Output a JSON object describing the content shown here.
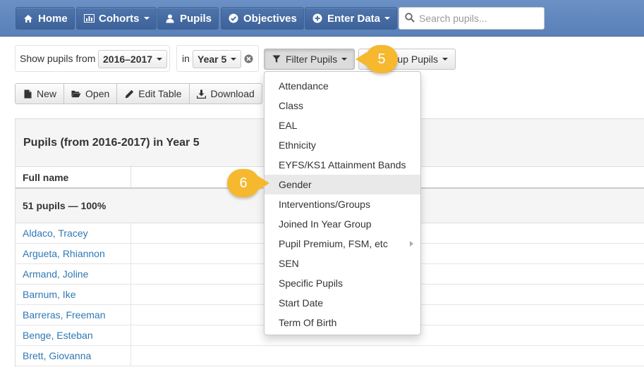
{
  "navbar": {
    "home": "Home",
    "cohorts": "Cohorts",
    "pupils": "Pupils",
    "objectives": "Objectives",
    "enter_data": "Enter Data",
    "search_placeholder": "Search pupils..."
  },
  "filterbar": {
    "show_from_label": "Show pupils from",
    "year_range": "2016–2017",
    "in_label": "in",
    "year_group": "Year 5",
    "filter_button": "Filter Pupils",
    "group_button_partial": "up Pupils"
  },
  "toolbar": {
    "new": "New",
    "open": "Open",
    "edit_table": "Edit Table",
    "download": "Download"
  },
  "table": {
    "title": "Pupils (from 2016-2017) in Year 5",
    "col_full_name": "Full name",
    "summary": "51 pupils — 100%",
    "rows": [
      "Aldaco, Tracey",
      "Argueta, Rhiannon",
      "Armand, Joline",
      "Barnum, Ike",
      "Barreras, Freeman",
      "Benge, Esteban",
      "Brett, Giovanna"
    ]
  },
  "filter_menu": {
    "items": [
      "Attendance",
      "Class",
      "EAL",
      "Ethnicity",
      "EYFS/KS1 Attainment Bands",
      "Gender",
      "Interventions/Groups",
      "Joined In Year Group",
      "Pupil Premium, FSM, etc",
      "SEN",
      "Specific Pupils",
      "Start Date",
      "Term Of Birth"
    ],
    "highlighted": "Gender"
  },
  "callouts": {
    "step_a": "5",
    "step_b": "6"
  },
  "colors": {
    "navbar": "#5a80b8",
    "nav_button": "#3d6299",
    "link": "#2f78b5",
    "callout": "#f5b82e"
  },
  "icons": [
    "home-icon",
    "bar-chart-icon",
    "user-icon",
    "check-circle-icon",
    "plus-circle-icon",
    "search-icon",
    "remove-circle-icon",
    "filter-icon",
    "file-icon",
    "folder-open-icon",
    "pencil-icon",
    "download-icon",
    "chevron-right-icon"
  ]
}
